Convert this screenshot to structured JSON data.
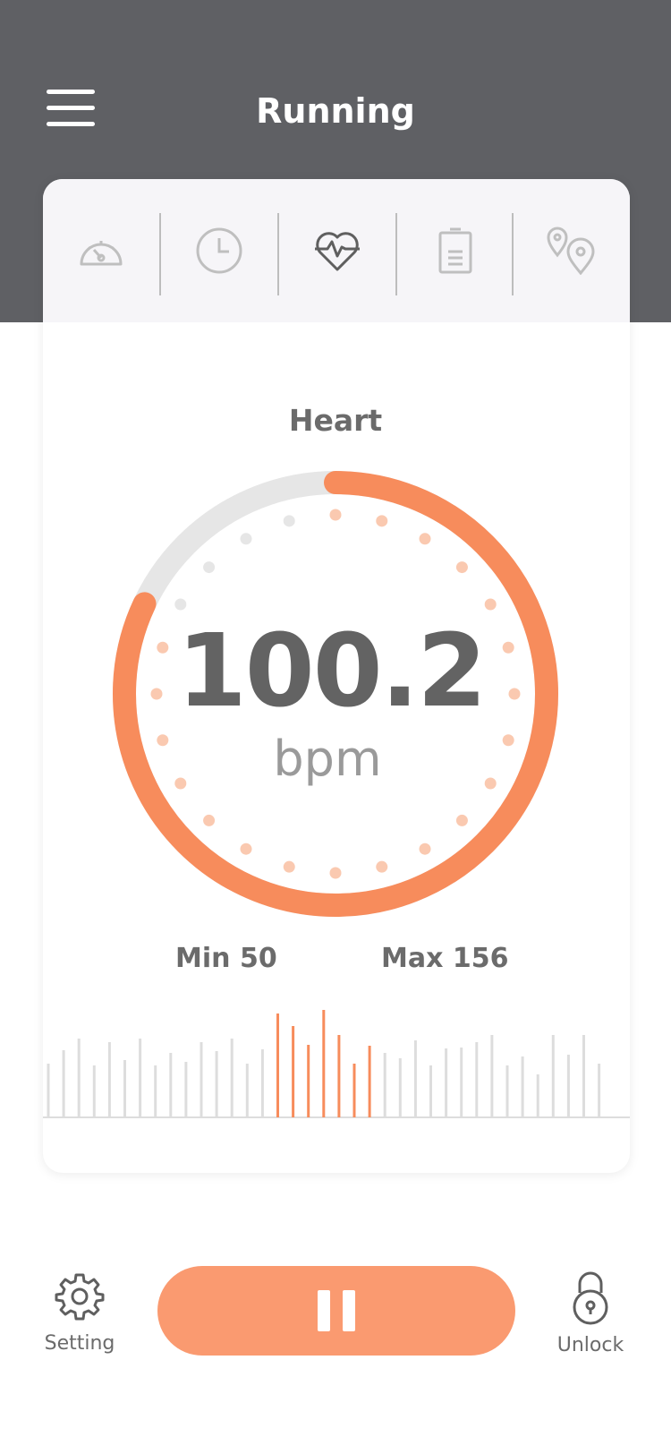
{
  "header": {
    "title": "Running"
  },
  "tabs": [
    {
      "icon": "speedometer-icon"
    },
    {
      "icon": "clock-icon"
    },
    {
      "icon": "heart-pulse-icon",
      "active": true
    },
    {
      "icon": "battery-icon"
    },
    {
      "icon": "location-pins-icon"
    }
  ],
  "metric": {
    "label": "Heart",
    "value": "100.2",
    "unit": "bpm",
    "progress_fraction": 0.82,
    "min_label": "Min 50",
    "max_label": "Max 156"
  },
  "chart_data": {
    "type": "bar",
    "values": [
      60,
      75,
      88,
      58,
      84,
      64,
      88,
      58,
      72,
      62,
      84,
      74,
      88,
      60,
      76,
      116,
      102,
      81,
      120,
      92,
      60,
      80,
      72,
      66,
      86,
      58,
      77,
      78,
      84,
      92,
      58,
      68,
      48,
      92,
      70,
      92,
      60
    ],
    "highlight_range": [
      15,
      21
    ]
  },
  "bottom": {
    "setting_label": "Setting",
    "unlock_label": "Unlock"
  },
  "colors": {
    "accent": "#f78c5c",
    "accent_light": "#fac9b0",
    "header_bg": "#5f6064",
    "track": "#e6e6e6"
  }
}
